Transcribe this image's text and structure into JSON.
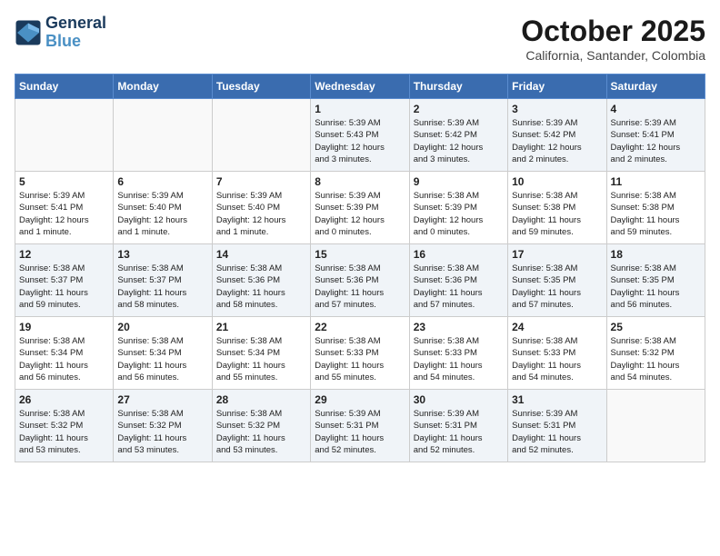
{
  "header": {
    "logo_line1": "General",
    "logo_line2": "Blue",
    "month": "October 2025",
    "location": "California, Santander, Colombia"
  },
  "days_of_week": [
    "Sunday",
    "Monday",
    "Tuesday",
    "Wednesday",
    "Thursday",
    "Friday",
    "Saturday"
  ],
  "weeks": [
    [
      {
        "day": "",
        "info": ""
      },
      {
        "day": "",
        "info": ""
      },
      {
        "day": "",
        "info": ""
      },
      {
        "day": "1",
        "info": "Sunrise: 5:39 AM\nSunset: 5:43 PM\nDaylight: 12 hours\nand 3 minutes."
      },
      {
        "day": "2",
        "info": "Sunrise: 5:39 AM\nSunset: 5:42 PM\nDaylight: 12 hours\nand 3 minutes."
      },
      {
        "day": "3",
        "info": "Sunrise: 5:39 AM\nSunset: 5:42 PM\nDaylight: 12 hours\nand 2 minutes."
      },
      {
        "day": "4",
        "info": "Sunrise: 5:39 AM\nSunset: 5:41 PM\nDaylight: 12 hours\nand 2 minutes."
      }
    ],
    [
      {
        "day": "5",
        "info": "Sunrise: 5:39 AM\nSunset: 5:41 PM\nDaylight: 12 hours\nand 1 minute."
      },
      {
        "day": "6",
        "info": "Sunrise: 5:39 AM\nSunset: 5:40 PM\nDaylight: 12 hours\nand 1 minute."
      },
      {
        "day": "7",
        "info": "Sunrise: 5:39 AM\nSunset: 5:40 PM\nDaylight: 12 hours\nand 1 minute."
      },
      {
        "day": "8",
        "info": "Sunrise: 5:39 AM\nSunset: 5:39 PM\nDaylight: 12 hours\nand 0 minutes."
      },
      {
        "day": "9",
        "info": "Sunrise: 5:38 AM\nSunset: 5:39 PM\nDaylight: 12 hours\nand 0 minutes."
      },
      {
        "day": "10",
        "info": "Sunrise: 5:38 AM\nSunset: 5:38 PM\nDaylight: 11 hours\nand 59 minutes."
      },
      {
        "day": "11",
        "info": "Sunrise: 5:38 AM\nSunset: 5:38 PM\nDaylight: 11 hours\nand 59 minutes."
      }
    ],
    [
      {
        "day": "12",
        "info": "Sunrise: 5:38 AM\nSunset: 5:37 PM\nDaylight: 11 hours\nand 59 minutes."
      },
      {
        "day": "13",
        "info": "Sunrise: 5:38 AM\nSunset: 5:37 PM\nDaylight: 11 hours\nand 58 minutes."
      },
      {
        "day": "14",
        "info": "Sunrise: 5:38 AM\nSunset: 5:36 PM\nDaylight: 11 hours\nand 58 minutes."
      },
      {
        "day": "15",
        "info": "Sunrise: 5:38 AM\nSunset: 5:36 PM\nDaylight: 11 hours\nand 57 minutes."
      },
      {
        "day": "16",
        "info": "Sunrise: 5:38 AM\nSunset: 5:36 PM\nDaylight: 11 hours\nand 57 minutes."
      },
      {
        "day": "17",
        "info": "Sunrise: 5:38 AM\nSunset: 5:35 PM\nDaylight: 11 hours\nand 57 minutes."
      },
      {
        "day": "18",
        "info": "Sunrise: 5:38 AM\nSunset: 5:35 PM\nDaylight: 11 hours\nand 56 minutes."
      }
    ],
    [
      {
        "day": "19",
        "info": "Sunrise: 5:38 AM\nSunset: 5:34 PM\nDaylight: 11 hours\nand 56 minutes."
      },
      {
        "day": "20",
        "info": "Sunrise: 5:38 AM\nSunset: 5:34 PM\nDaylight: 11 hours\nand 56 minutes."
      },
      {
        "day": "21",
        "info": "Sunrise: 5:38 AM\nSunset: 5:34 PM\nDaylight: 11 hours\nand 55 minutes."
      },
      {
        "day": "22",
        "info": "Sunrise: 5:38 AM\nSunset: 5:33 PM\nDaylight: 11 hours\nand 55 minutes."
      },
      {
        "day": "23",
        "info": "Sunrise: 5:38 AM\nSunset: 5:33 PM\nDaylight: 11 hours\nand 54 minutes."
      },
      {
        "day": "24",
        "info": "Sunrise: 5:38 AM\nSunset: 5:33 PM\nDaylight: 11 hours\nand 54 minutes."
      },
      {
        "day": "25",
        "info": "Sunrise: 5:38 AM\nSunset: 5:32 PM\nDaylight: 11 hours\nand 54 minutes."
      }
    ],
    [
      {
        "day": "26",
        "info": "Sunrise: 5:38 AM\nSunset: 5:32 PM\nDaylight: 11 hours\nand 53 minutes."
      },
      {
        "day": "27",
        "info": "Sunrise: 5:38 AM\nSunset: 5:32 PM\nDaylight: 11 hours\nand 53 minutes."
      },
      {
        "day": "28",
        "info": "Sunrise: 5:38 AM\nSunset: 5:32 PM\nDaylight: 11 hours\nand 53 minutes."
      },
      {
        "day": "29",
        "info": "Sunrise: 5:39 AM\nSunset: 5:31 PM\nDaylight: 11 hours\nand 52 minutes."
      },
      {
        "day": "30",
        "info": "Sunrise: 5:39 AM\nSunset: 5:31 PM\nDaylight: 11 hours\nand 52 minutes."
      },
      {
        "day": "31",
        "info": "Sunrise: 5:39 AM\nSunset: 5:31 PM\nDaylight: 11 hours\nand 52 minutes."
      },
      {
        "day": "",
        "info": ""
      }
    ]
  ]
}
